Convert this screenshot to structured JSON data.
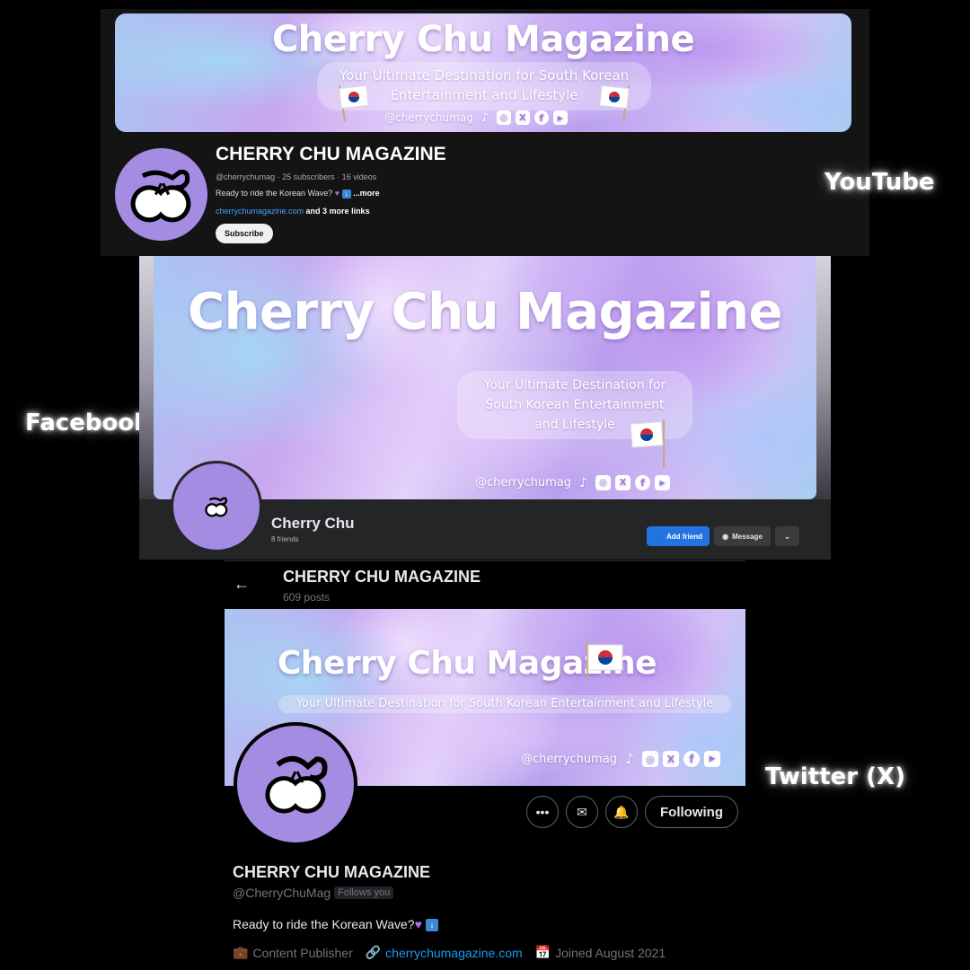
{
  "labels": {
    "youtube": "YouTube",
    "facebook": "Facebook",
    "twitter": "Twitter (X)"
  },
  "banner": {
    "title": "Cherry Chu Magazine",
    "tagline_line1": "Your Ultimate Destination for South Korean",
    "tagline_line2": "Entertainment and Lifestyle",
    "fb_tagline_line1": "Your Ultimate Destination for",
    "fb_tagline_line2": "South Korean Entertainment",
    "fb_tagline_line3": "and Lifestyle",
    "tw_tagline": "Your Ultimate Destination for South Korean Entertainment and Lifestyle",
    "handle": "@cherrychumag",
    "social_icons": [
      "tiktok-icon",
      "instagram-icon",
      "x-icon",
      "facebook-icon",
      "youtube-icon"
    ]
  },
  "youtube": {
    "channel_name": "CHERRY CHU MAGAZINE",
    "meta": "@cherrychumag · 25 subscribers · 16 videos",
    "description": "Ready to ride the Korean Wave?",
    "more": "...more",
    "link": "cherrychumagazine.com",
    "more_links": " and 3 more links",
    "subscribe": "Subscribe"
  },
  "facebook": {
    "name": "Cherry Chu",
    "friends": "8 friends",
    "add_friend": "Add friend",
    "message": "Message"
  },
  "twitter": {
    "header_name": "CHERRY CHU MAGAZINE",
    "posts": "609 posts",
    "name": "CHERRY CHU MAGAZINE",
    "handle": "@CherryChuMag",
    "follows_you": "Follows you",
    "bio": "Ready to ride the Korean Wave?",
    "category": "Content Publisher",
    "url": "cherrychumagazine.com",
    "joined": "Joined August 2021",
    "following": "Following"
  },
  "colors": {
    "avatar": "#a58ce3",
    "fb_blue": "#2374e1",
    "tw_link": "#1d9bf0",
    "yt_link": "#3ea6ff"
  }
}
